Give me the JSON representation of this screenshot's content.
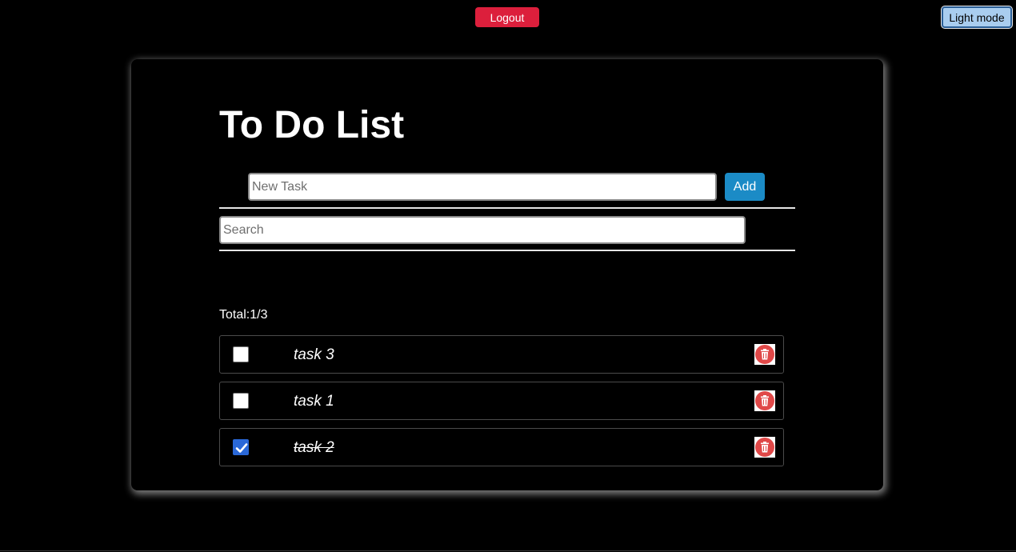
{
  "header": {
    "logout_label": "Logout",
    "mode_toggle_label": "Light mode"
  },
  "card": {
    "title": "To Do List",
    "new_task": {
      "value": "",
      "placeholder": "New Task"
    },
    "add_label": "Add",
    "search": {
      "value": "",
      "placeholder": "Search"
    },
    "total_text": "Total:1/3"
  },
  "tasks": [
    {
      "text": "task 3",
      "completed": false,
      "delete_icon": "trash-icon"
    },
    {
      "text": "task 1",
      "completed": false,
      "delete_icon": "trash-icon"
    },
    {
      "text": "task 2",
      "completed": true,
      "delete_icon": "trash-icon"
    }
  ],
  "colors": {
    "logout_bg": "#dc1f3c",
    "add_bg": "#1b8bc6",
    "mode_bg": "#a9cdef",
    "checkbox_checked": "#2a68d8",
    "delete_red": "#e04848"
  }
}
